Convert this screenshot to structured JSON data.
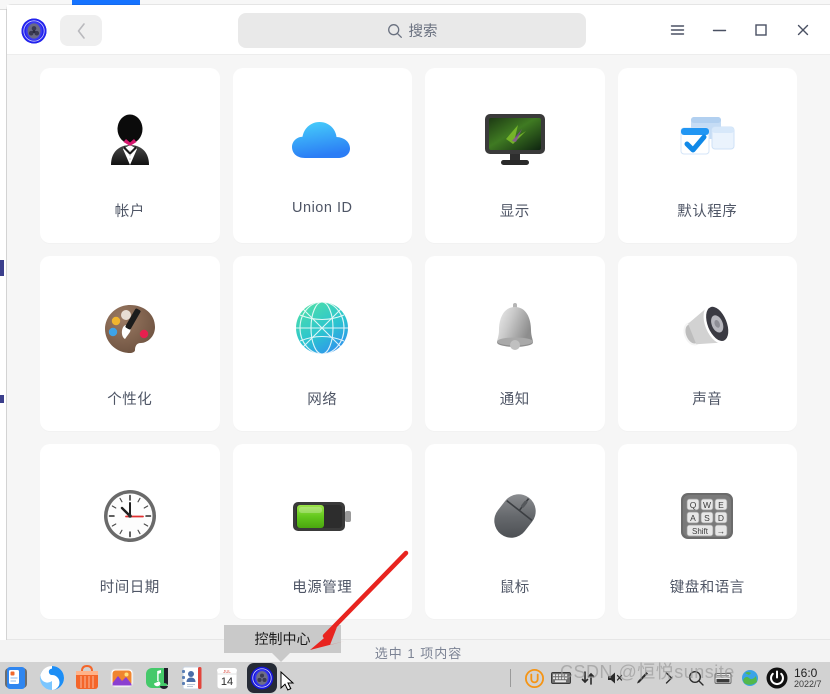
{
  "window": {
    "app_icon": "control-center-gear-icon",
    "back_label": "‹",
    "menu_icon": "hamburger-menu-icon",
    "minimize_icon": "minimize-icon",
    "maximize_icon": "maximize-icon",
    "close_icon": "close-icon"
  },
  "search": {
    "icon": "search-icon",
    "placeholder": "搜索",
    "value": ""
  },
  "grid": {
    "items": [
      {
        "label": "帐户",
        "icon": "user-tuxedo-icon"
      },
      {
        "label": "Union ID",
        "icon": "cloud-icon"
      },
      {
        "label": "显示",
        "icon": "monitor-icon"
      },
      {
        "label": "默认程序",
        "icon": "default-apps-checkmark-icon"
      },
      {
        "label": "个性化",
        "icon": "paint-palette-icon"
      },
      {
        "label": "网络",
        "icon": "globe-network-icon"
      },
      {
        "label": "通知",
        "icon": "bell-icon"
      },
      {
        "label": "声音",
        "icon": "speaker-icon"
      },
      {
        "label": "时间日期",
        "icon": "clock-icon"
      },
      {
        "label": "电源管理",
        "icon": "battery-icon"
      },
      {
        "label": "鼠标",
        "icon": "mouse-icon"
      },
      {
        "label": "键盘和语言",
        "icon": "keyboard-icon"
      }
    ]
  },
  "keyboard_icon_keys": {
    "row1": [
      "Q",
      "W",
      "E"
    ],
    "row2": [
      "A",
      "S",
      "D"
    ],
    "row3": [
      "Shift",
      "→"
    ]
  },
  "statusbar": {
    "text": "选中 1 项内容"
  },
  "tooltip": {
    "text": "控制中心"
  },
  "taskbar": {
    "launchers": [
      {
        "name": "file-manager-icon"
      },
      {
        "name": "browser-icon"
      },
      {
        "name": "app-store-icon"
      },
      {
        "name": "gallery-icon"
      },
      {
        "name": "music-icon"
      },
      {
        "name": "contacts-icon"
      },
      {
        "name": "calendar-icon",
        "day": "14",
        "month": "JUL"
      },
      {
        "name": "control-center-icon",
        "active": true
      }
    ],
    "tray": [
      {
        "name": "uos-assistant-icon",
        "glyph": "U"
      },
      {
        "name": "onboard-keyboard-icon"
      },
      {
        "name": "network-icon"
      },
      {
        "name": "volume-mute-icon"
      },
      {
        "name": "brightness-pen-icon"
      },
      {
        "name": "tray-expand-icon",
        "glyph": "›"
      },
      {
        "name": "search-icon"
      },
      {
        "name": "screenshot-icon"
      },
      {
        "name": "globe-icon"
      },
      {
        "name": "power-icon"
      }
    ],
    "clock": {
      "time": "16:0",
      "date": "2022/7"
    }
  },
  "watermark": {
    "text": "CSDN @恒悦sunsite"
  },
  "colors": {
    "accent": "#1673ff",
    "window_bg": "#f6f6f6",
    "card_bg": "#ffffff",
    "label": "#4f5666",
    "taskbar_bg": "#d2d2d2",
    "tooltip_bg": "#c9c9c9",
    "annotation": "#e8241f"
  }
}
